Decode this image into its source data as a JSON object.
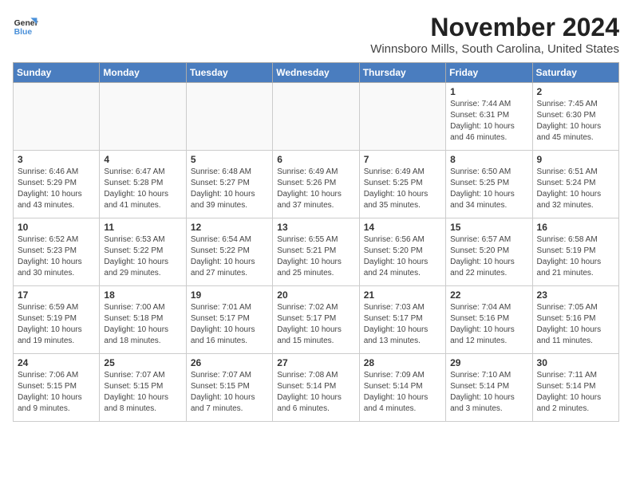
{
  "logo": {
    "line1": "General",
    "line2": "Blue"
  },
  "title": "November 2024",
  "subtitle": "Winnsboro Mills, South Carolina, United States",
  "weekdays": [
    "Sunday",
    "Monday",
    "Tuesday",
    "Wednesday",
    "Thursday",
    "Friday",
    "Saturday"
  ],
  "weeks": [
    [
      {
        "day": "",
        "detail": "",
        "empty": true
      },
      {
        "day": "",
        "detail": "",
        "empty": true
      },
      {
        "day": "",
        "detail": "",
        "empty": true
      },
      {
        "day": "",
        "detail": "",
        "empty": true
      },
      {
        "day": "",
        "detail": "",
        "empty": true
      },
      {
        "day": "1",
        "detail": "Sunrise: 7:44 AM\nSunset: 6:31 PM\nDaylight: 10 hours\nand 46 minutes."
      },
      {
        "day": "2",
        "detail": "Sunrise: 7:45 AM\nSunset: 6:30 PM\nDaylight: 10 hours\nand 45 minutes."
      }
    ],
    [
      {
        "day": "3",
        "detail": "Sunrise: 6:46 AM\nSunset: 5:29 PM\nDaylight: 10 hours\nand 43 minutes."
      },
      {
        "day": "4",
        "detail": "Sunrise: 6:47 AM\nSunset: 5:28 PM\nDaylight: 10 hours\nand 41 minutes."
      },
      {
        "day": "5",
        "detail": "Sunrise: 6:48 AM\nSunset: 5:27 PM\nDaylight: 10 hours\nand 39 minutes."
      },
      {
        "day": "6",
        "detail": "Sunrise: 6:49 AM\nSunset: 5:26 PM\nDaylight: 10 hours\nand 37 minutes."
      },
      {
        "day": "7",
        "detail": "Sunrise: 6:49 AM\nSunset: 5:25 PM\nDaylight: 10 hours\nand 35 minutes."
      },
      {
        "day": "8",
        "detail": "Sunrise: 6:50 AM\nSunset: 5:25 PM\nDaylight: 10 hours\nand 34 minutes."
      },
      {
        "day": "9",
        "detail": "Sunrise: 6:51 AM\nSunset: 5:24 PM\nDaylight: 10 hours\nand 32 minutes."
      }
    ],
    [
      {
        "day": "10",
        "detail": "Sunrise: 6:52 AM\nSunset: 5:23 PM\nDaylight: 10 hours\nand 30 minutes."
      },
      {
        "day": "11",
        "detail": "Sunrise: 6:53 AM\nSunset: 5:22 PM\nDaylight: 10 hours\nand 29 minutes."
      },
      {
        "day": "12",
        "detail": "Sunrise: 6:54 AM\nSunset: 5:22 PM\nDaylight: 10 hours\nand 27 minutes."
      },
      {
        "day": "13",
        "detail": "Sunrise: 6:55 AM\nSunset: 5:21 PM\nDaylight: 10 hours\nand 25 minutes."
      },
      {
        "day": "14",
        "detail": "Sunrise: 6:56 AM\nSunset: 5:20 PM\nDaylight: 10 hours\nand 24 minutes."
      },
      {
        "day": "15",
        "detail": "Sunrise: 6:57 AM\nSunset: 5:20 PM\nDaylight: 10 hours\nand 22 minutes."
      },
      {
        "day": "16",
        "detail": "Sunrise: 6:58 AM\nSunset: 5:19 PM\nDaylight: 10 hours\nand 21 minutes."
      }
    ],
    [
      {
        "day": "17",
        "detail": "Sunrise: 6:59 AM\nSunset: 5:19 PM\nDaylight: 10 hours\nand 19 minutes."
      },
      {
        "day": "18",
        "detail": "Sunrise: 7:00 AM\nSunset: 5:18 PM\nDaylight: 10 hours\nand 18 minutes."
      },
      {
        "day": "19",
        "detail": "Sunrise: 7:01 AM\nSunset: 5:17 PM\nDaylight: 10 hours\nand 16 minutes."
      },
      {
        "day": "20",
        "detail": "Sunrise: 7:02 AM\nSunset: 5:17 PM\nDaylight: 10 hours\nand 15 minutes."
      },
      {
        "day": "21",
        "detail": "Sunrise: 7:03 AM\nSunset: 5:17 PM\nDaylight: 10 hours\nand 13 minutes."
      },
      {
        "day": "22",
        "detail": "Sunrise: 7:04 AM\nSunset: 5:16 PM\nDaylight: 10 hours\nand 12 minutes."
      },
      {
        "day": "23",
        "detail": "Sunrise: 7:05 AM\nSunset: 5:16 PM\nDaylight: 10 hours\nand 11 minutes."
      }
    ],
    [
      {
        "day": "24",
        "detail": "Sunrise: 7:06 AM\nSunset: 5:15 PM\nDaylight: 10 hours\nand 9 minutes."
      },
      {
        "day": "25",
        "detail": "Sunrise: 7:07 AM\nSunset: 5:15 PM\nDaylight: 10 hours\nand 8 minutes."
      },
      {
        "day": "26",
        "detail": "Sunrise: 7:07 AM\nSunset: 5:15 PM\nDaylight: 10 hours\nand 7 minutes."
      },
      {
        "day": "27",
        "detail": "Sunrise: 7:08 AM\nSunset: 5:14 PM\nDaylight: 10 hours\nand 6 minutes."
      },
      {
        "day": "28",
        "detail": "Sunrise: 7:09 AM\nSunset: 5:14 PM\nDaylight: 10 hours\nand 4 minutes."
      },
      {
        "day": "29",
        "detail": "Sunrise: 7:10 AM\nSunset: 5:14 PM\nDaylight: 10 hours\nand 3 minutes."
      },
      {
        "day": "30",
        "detail": "Sunrise: 7:11 AM\nSunset: 5:14 PM\nDaylight: 10 hours\nand 2 minutes."
      }
    ]
  ]
}
